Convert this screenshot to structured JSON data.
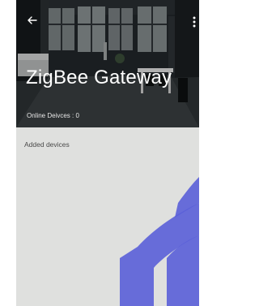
{
  "header": {
    "title": "ZigBee Gateway",
    "online_label": "Online Deivces :",
    "online_count": "0",
    "back_icon": "arrow-left-icon",
    "more_icon": "more-vert-icon"
  },
  "content": {
    "section_label": "Added devices"
  },
  "colors": {
    "background": "#dfe0de",
    "watermark": "#5a5fd8"
  }
}
